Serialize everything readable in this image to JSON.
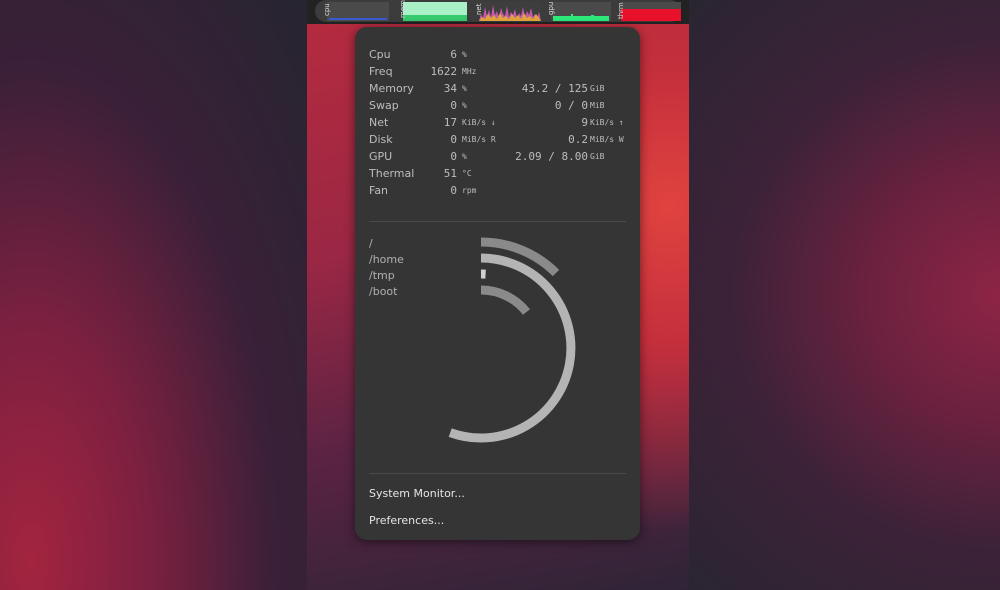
{
  "panel": {
    "graphs": [
      {
        "label": "cpu"
      },
      {
        "label": "mem"
      },
      {
        "label": "net"
      },
      {
        "label": "gpu"
      },
      {
        "label": "thrm"
      }
    ]
  },
  "stats": [
    {
      "name": "Cpu",
      "value": "6",
      "unit": "%",
      "value2": "",
      "unit2": ""
    },
    {
      "name": "Freq",
      "value": "1622",
      "unit": "MHz",
      "value2": "",
      "unit2": ""
    },
    {
      "name": "Memory",
      "value": "34",
      "unit": "%",
      "value2": "43.2  /  125",
      "unit2": "GiB"
    },
    {
      "name": "Swap",
      "value": "0",
      "unit": "%",
      "value2": "0  /  0",
      "unit2": "MiB"
    },
    {
      "name": "Net",
      "value": "17",
      "unit": "KiB/s ↓",
      "value2": "9",
      "unit2": "KiB/s ↑"
    },
    {
      "name": "Disk",
      "value": "0",
      "unit": "MiB/s R",
      "value2": "0.2",
      "unit2": "MiB/s W"
    },
    {
      "name": "GPU",
      "value": "0",
      "unit": "%",
      "value2": "2.09   /   8.00",
      "unit2": "GiB"
    },
    {
      "name": "Thermal",
      "value": "51",
      "unit": "°C",
      "value2": "",
      "unit2": ""
    },
    {
      "name": "Fan",
      "value": "0",
      "unit": "rpm",
      "value2": "",
      "unit2": ""
    }
  ],
  "mounts": [
    "/",
    "/home",
    "/tmp",
    "/boot"
  ],
  "actions": {
    "system_monitor": "System Monitor...",
    "preferences": "Preferences..."
  },
  "colors": {
    "menu_bg": "#353535",
    "mem_graph": "#a8f0c6",
    "thermal_graph": "#e8102a",
    "gpu_graph": "#2ee87a",
    "net_graph": "#e2a43c"
  }
}
